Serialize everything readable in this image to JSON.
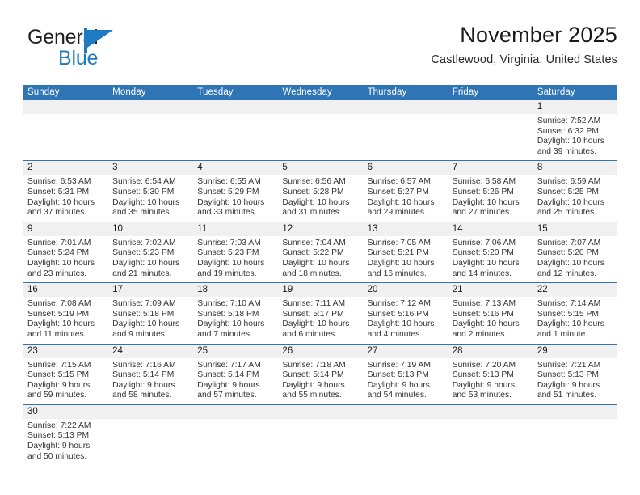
{
  "brand": {
    "name_top": "General",
    "name_bottom": "Blue",
    "mark_icon": "triangle-logo-icon",
    "accent_color": "#1f7ac4"
  },
  "header": {
    "title": "November 2025",
    "subtitle": "Castlewood, Virginia, United States"
  },
  "calendar": {
    "header_color": "#2f74b5",
    "weekdays": [
      "Sunday",
      "Monday",
      "Tuesday",
      "Wednesday",
      "Thursday",
      "Friday",
      "Saturday"
    ],
    "weeks": [
      [
        {
          "empty": true
        },
        {
          "empty": true
        },
        {
          "empty": true
        },
        {
          "empty": true
        },
        {
          "empty": true
        },
        {
          "empty": true
        },
        {
          "day": "1",
          "sunrise": "Sunrise: 7:52 AM",
          "sunset": "Sunset: 6:32 PM",
          "daylight_1": "Daylight: 10 hours",
          "daylight_2": "and 39 minutes."
        }
      ],
      [
        {
          "day": "2",
          "sunrise": "Sunrise: 6:53 AM",
          "sunset": "Sunset: 5:31 PM",
          "daylight_1": "Daylight: 10 hours",
          "daylight_2": "and 37 minutes."
        },
        {
          "day": "3",
          "sunrise": "Sunrise: 6:54 AM",
          "sunset": "Sunset: 5:30 PM",
          "daylight_1": "Daylight: 10 hours",
          "daylight_2": "and 35 minutes."
        },
        {
          "day": "4",
          "sunrise": "Sunrise: 6:55 AM",
          "sunset": "Sunset: 5:29 PM",
          "daylight_1": "Daylight: 10 hours",
          "daylight_2": "and 33 minutes."
        },
        {
          "day": "5",
          "sunrise": "Sunrise: 6:56 AM",
          "sunset": "Sunset: 5:28 PM",
          "daylight_1": "Daylight: 10 hours",
          "daylight_2": "and 31 minutes."
        },
        {
          "day": "6",
          "sunrise": "Sunrise: 6:57 AM",
          "sunset": "Sunset: 5:27 PM",
          "daylight_1": "Daylight: 10 hours",
          "daylight_2": "and 29 minutes."
        },
        {
          "day": "7",
          "sunrise": "Sunrise: 6:58 AM",
          "sunset": "Sunset: 5:26 PM",
          "daylight_1": "Daylight: 10 hours",
          "daylight_2": "and 27 minutes."
        },
        {
          "day": "8",
          "sunrise": "Sunrise: 6:59 AM",
          "sunset": "Sunset: 5:25 PM",
          "daylight_1": "Daylight: 10 hours",
          "daylight_2": "and 25 minutes."
        }
      ],
      [
        {
          "day": "9",
          "sunrise": "Sunrise: 7:01 AM",
          "sunset": "Sunset: 5:24 PM",
          "daylight_1": "Daylight: 10 hours",
          "daylight_2": "and 23 minutes."
        },
        {
          "day": "10",
          "sunrise": "Sunrise: 7:02 AM",
          "sunset": "Sunset: 5:23 PM",
          "daylight_1": "Daylight: 10 hours",
          "daylight_2": "and 21 minutes."
        },
        {
          "day": "11",
          "sunrise": "Sunrise: 7:03 AM",
          "sunset": "Sunset: 5:23 PM",
          "daylight_1": "Daylight: 10 hours",
          "daylight_2": "and 19 minutes."
        },
        {
          "day": "12",
          "sunrise": "Sunrise: 7:04 AM",
          "sunset": "Sunset: 5:22 PM",
          "daylight_1": "Daylight: 10 hours",
          "daylight_2": "and 18 minutes."
        },
        {
          "day": "13",
          "sunrise": "Sunrise: 7:05 AM",
          "sunset": "Sunset: 5:21 PM",
          "daylight_1": "Daylight: 10 hours",
          "daylight_2": "and 16 minutes."
        },
        {
          "day": "14",
          "sunrise": "Sunrise: 7:06 AM",
          "sunset": "Sunset: 5:20 PM",
          "daylight_1": "Daylight: 10 hours",
          "daylight_2": "and 14 minutes."
        },
        {
          "day": "15",
          "sunrise": "Sunrise: 7:07 AM",
          "sunset": "Sunset: 5:20 PM",
          "daylight_1": "Daylight: 10 hours",
          "daylight_2": "and 12 minutes."
        }
      ],
      [
        {
          "day": "16",
          "sunrise": "Sunrise: 7:08 AM",
          "sunset": "Sunset: 5:19 PM",
          "daylight_1": "Daylight: 10 hours",
          "daylight_2": "and 11 minutes."
        },
        {
          "day": "17",
          "sunrise": "Sunrise: 7:09 AM",
          "sunset": "Sunset: 5:18 PM",
          "daylight_1": "Daylight: 10 hours",
          "daylight_2": "and 9 minutes."
        },
        {
          "day": "18",
          "sunrise": "Sunrise: 7:10 AM",
          "sunset": "Sunset: 5:18 PM",
          "daylight_1": "Daylight: 10 hours",
          "daylight_2": "and 7 minutes."
        },
        {
          "day": "19",
          "sunrise": "Sunrise: 7:11 AM",
          "sunset": "Sunset: 5:17 PM",
          "daylight_1": "Daylight: 10 hours",
          "daylight_2": "and 6 minutes."
        },
        {
          "day": "20",
          "sunrise": "Sunrise: 7:12 AM",
          "sunset": "Sunset: 5:16 PM",
          "daylight_1": "Daylight: 10 hours",
          "daylight_2": "and 4 minutes."
        },
        {
          "day": "21",
          "sunrise": "Sunrise: 7:13 AM",
          "sunset": "Sunset: 5:16 PM",
          "daylight_1": "Daylight: 10 hours",
          "daylight_2": "and 2 minutes."
        },
        {
          "day": "22",
          "sunrise": "Sunrise: 7:14 AM",
          "sunset": "Sunset: 5:15 PM",
          "daylight_1": "Daylight: 10 hours",
          "daylight_2": "and 1 minute."
        }
      ],
      [
        {
          "day": "23",
          "sunrise": "Sunrise: 7:15 AM",
          "sunset": "Sunset: 5:15 PM",
          "daylight_1": "Daylight: 9 hours",
          "daylight_2": "and 59 minutes."
        },
        {
          "day": "24",
          "sunrise": "Sunrise: 7:16 AM",
          "sunset": "Sunset: 5:14 PM",
          "daylight_1": "Daylight: 9 hours",
          "daylight_2": "and 58 minutes."
        },
        {
          "day": "25",
          "sunrise": "Sunrise: 7:17 AM",
          "sunset": "Sunset: 5:14 PM",
          "daylight_1": "Daylight: 9 hours",
          "daylight_2": "and 57 minutes."
        },
        {
          "day": "26",
          "sunrise": "Sunrise: 7:18 AM",
          "sunset": "Sunset: 5:14 PM",
          "daylight_1": "Daylight: 9 hours",
          "daylight_2": "and 55 minutes."
        },
        {
          "day": "27",
          "sunrise": "Sunrise: 7:19 AM",
          "sunset": "Sunset: 5:13 PM",
          "daylight_1": "Daylight: 9 hours",
          "daylight_2": "and 54 minutes."
        },
        {
          "day": "28",
          "sunrise": "Sunrise: 7:20 AM",
          "sunset": "Sunset: 5:13 PM",
          "daylight_1": "Daylight: 9 hours",
          "daylight_2": "and 53 minutes."
        },
        {
          "day": "29",
          "sunrise": "Sunrise: 7:21 AM",
          "sunset": "Sunset: 5:13 PM",
          "daylight_1": "Daylight: 9 hours",
          "daylight_2": "and 51 minutes."
        }
      ],
      [
        {
          "day": "30",
          "sunrise": "Sunrise: 7:22 AM",
          "sunset": "Sunset: 5:13 PM",
          "daylight_1": "Daylight: 9 hours",
          "daylight_2": "and 50 minutes."
        },
        {
          "empty": true
        },
        {
          "empty": true
        },
        {
          "empty": true
        },
        {
          "empty": true
        },
        {
          "empty": true
        },
        {
          "empty": true
        }
      ]
    ]
  }
}
